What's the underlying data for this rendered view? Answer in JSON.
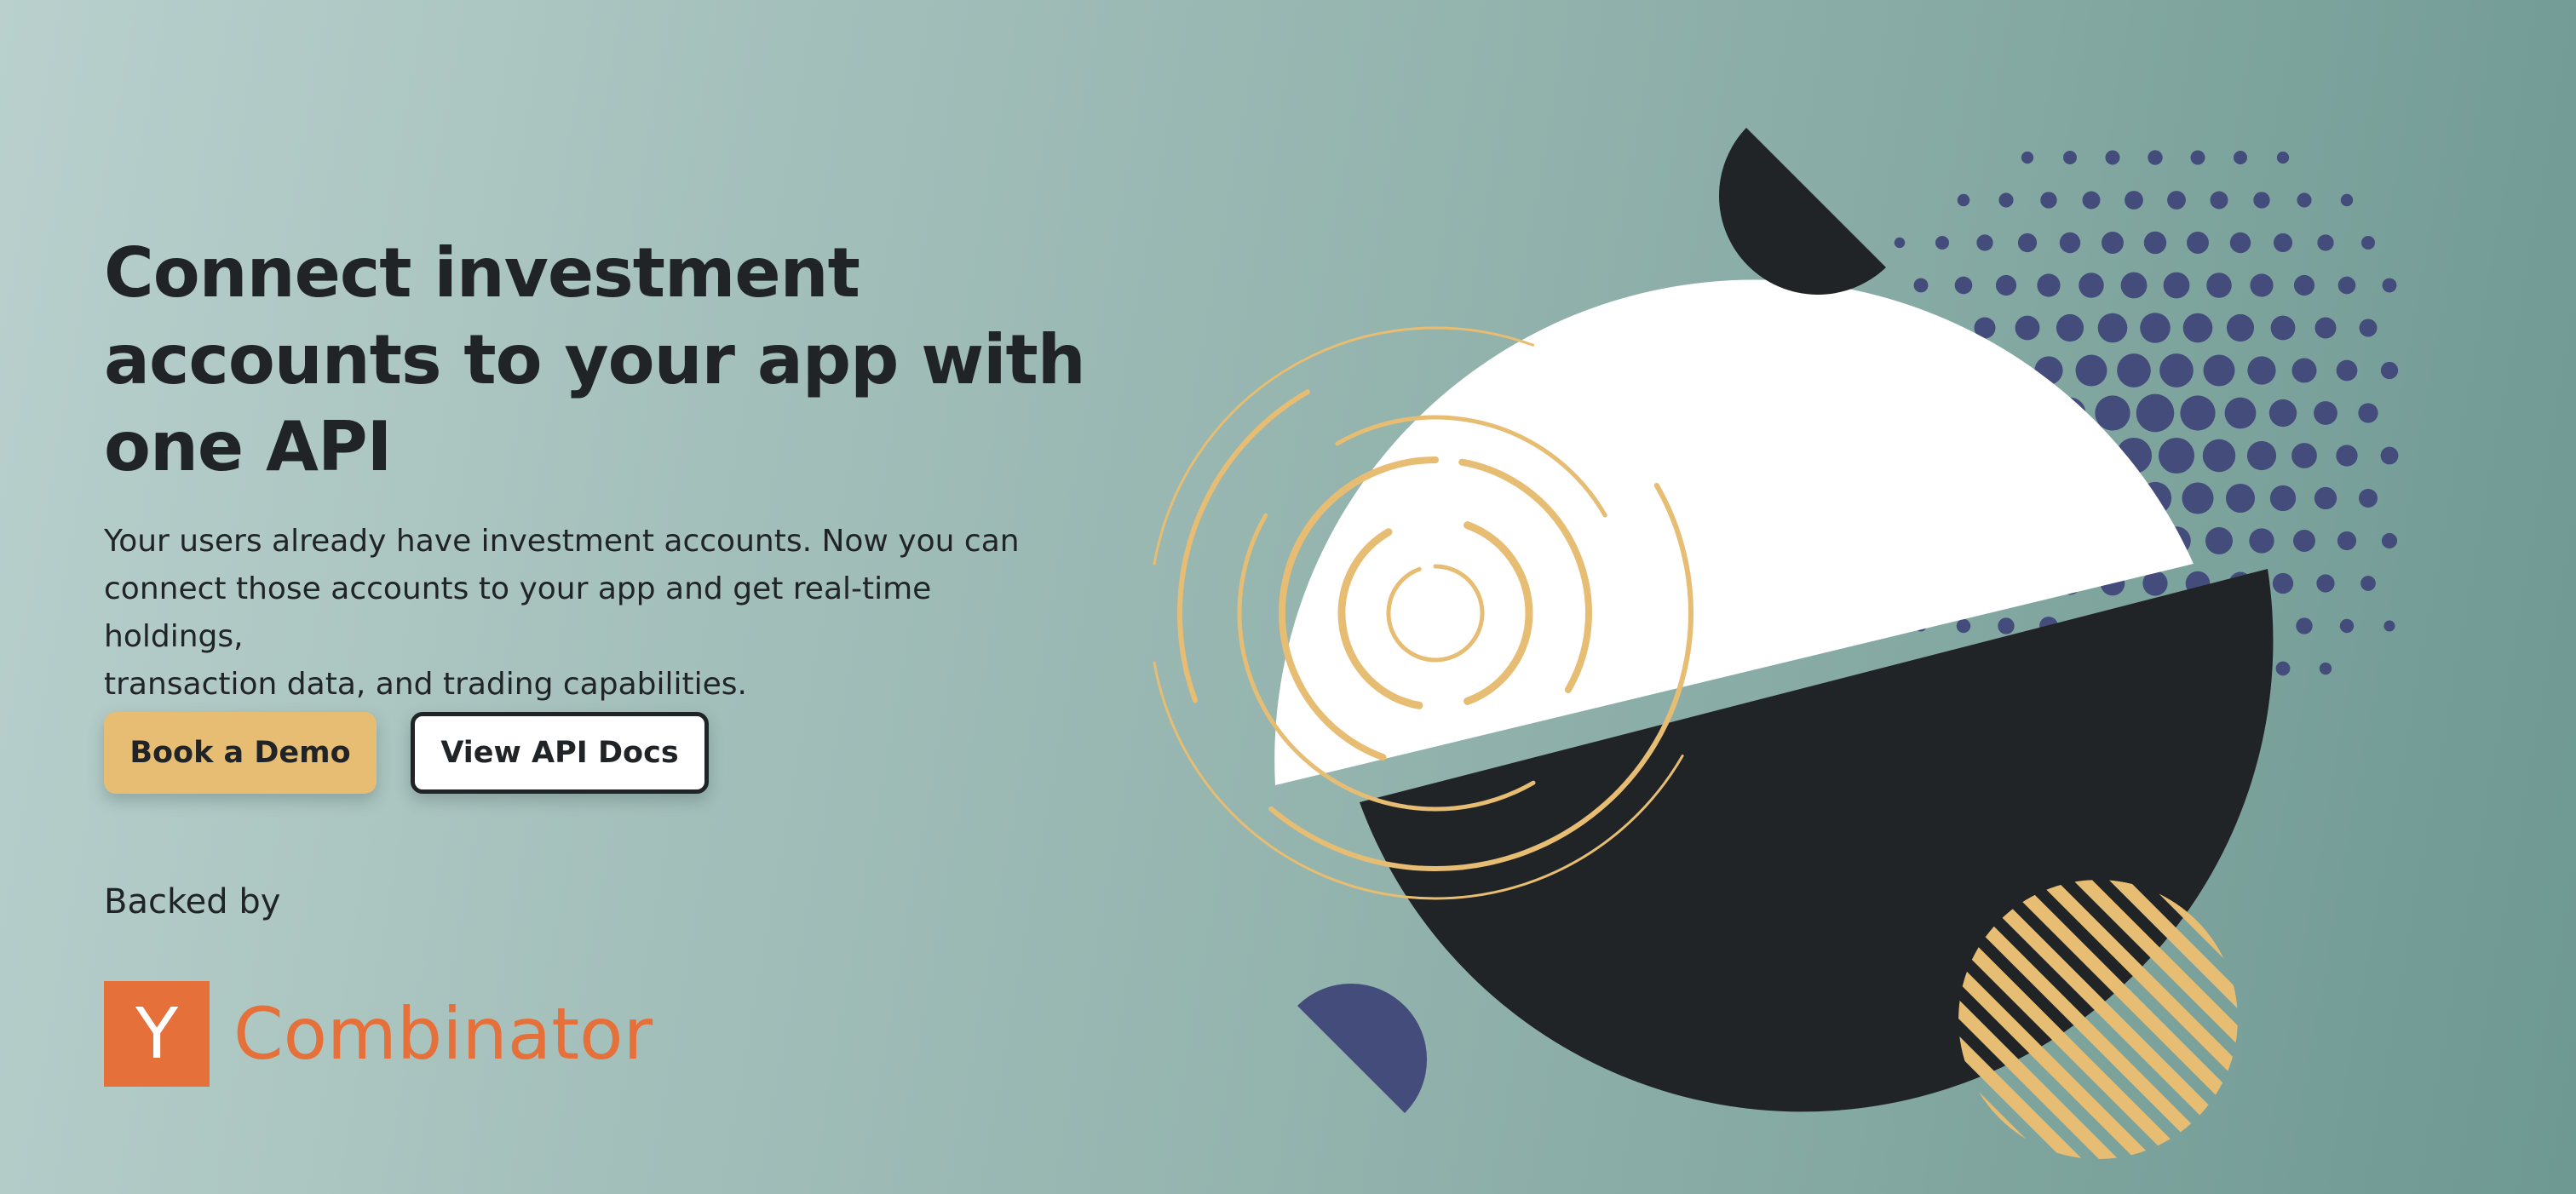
{
  "hero": {
    "headline_line1": "Connect investment",
    "headline_line2": "accounts to your app with",
    "headline_line3": "one API",
    "subtext_line1": "Your users already have investment accounts. Now you can",
    "subtext_line2": "connect those accounts to your app and get real-time holdings,",
    "subtext_line3": "transaction data, and trading capabilities."
  },
  "cta": {
    "primary_label": "Book a Demo",
    "secondary_label": "View API Docs"
  },
  "backers": {
    "label": "Backed by",
    "logo_letter": "Y",
    "logo_word": "Combinator"
  },
  "colors": {
    "dark": "#212426",
    "accent_gold": "#e6bd72",
    "navy": "#434c7a",
    "yc_orange": "#e5703a",
    "white": "#ffffff"
  },
  "illustration": {
    "icons": [
      "white-semicircle",
      "dark-semicircle",
      "dot-pattern",
      "concentric-rings",
      "striped-circle",
      "small-dark-semicircle",
      "small-navy-semicircle"
    ]
  }
}
